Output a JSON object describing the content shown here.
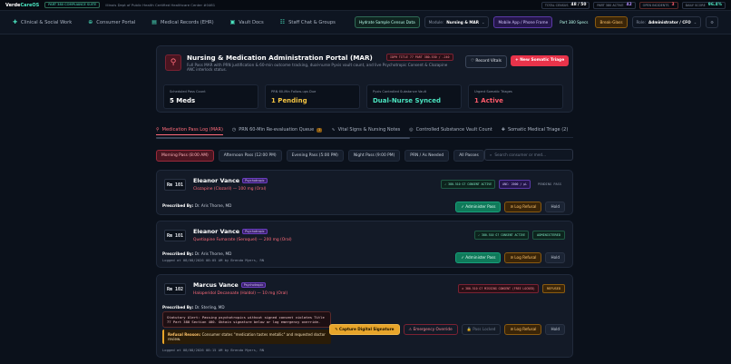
{
  "topbar": {
    "brand_a": "Verde",
    "brand_b": "CareOS",
    "suite": "PART 380 COMPLIANCE SUITE",
    "facility": "Illinois Dept of Public Health Certified Healthcare Center #0461",
    "stats": [
      {
        "label": "TOTAL CENSUS",
        "value": "48 / 50"
      },
      {
        "label": "PART 380 ACTIVE",
        "value": "42"
      },
      {
        "label": "OPEN INCIDENTS",
        "value": "3"
      },
      {
        "label": "DAILY SCORE",
        "value": "96.4%"
      }
    ]
  },
  "nav": {
    "items": [
      {
        "icon": "✚",
        "label": "Clinical & Social Work"
      },
      {
        "icon": "⊕",
        "label": "Consumer Portal"
      },
      {
        "icon": "▤",
        "label": "Medical Records (EHR)"
      },
      {
        "icon": "▣",
        "label": "Vault Docs"
      },
      {
        "icon": "☷",
        "label": "Staff Chat & Groups"
      }
    ],
    "hydrate": "Hydrate Sample Census Data",
    "module_label": "Module:",
    "module_value": "Nursing & MAR",
    "mobile": "Mobile App / Phone Frame",
    "part380": "Part 380 Specs",
    "breakglass": "Break-Glass",
    "role_label": "Role:",
    "role_value": "Administrator / CFO"
  },
  "hero": {
    "title": "Nursing & Medication Administration Portal (MAR)",
    "tag": "IDPH TITLE 77 PART 380.530 / .240",
    "desc": "Full Pass MAR with PRN justification & 60-min outcome tracking, dual-nurse Pyxis vault count, and live Psychotropic Consent & Clozapine ANC interlock status.",
    "record_vitals": "Record Vitals",
    "new_triage": "New Somatic Triage",
    "cards": [
      {
        "label": "Scheduled Pass Count",
        "value": "5 Meds",
        "color": "#ffffff"
      },
      {
        "label": "PRN 60-Min Follow-ups Due",
        "value": "1 Pending",
        "color": "#f5c542"
      },
      {
        "label": "Pyxis Controlled Substance Vault",
        "value": "Dual-Nurse Synced",
        "color": "#4be4c0"
      },
      {
        "label": "Urgent Somatic Triages",
        "value": "1 Active",
        "color": "#ff5a6a"
      }
    ]
  },
  "tabs": [
    {
      "icon": "⚲",
      "label": "Medication Pass Log (MAR)",
      "badge": ""
    },
    {
      "icon": "◷",
      "label": "PRN 60-Min Re-evaluation Queue",
      "badge": "1"
    },
    {
      "icon": "∿",
      "label": "Vital Signs & Nursing Notes",
      "badge": ""
    },
    {
      "icon": "◎",
      "label": "Controlled Substance Vault Count",
      "badge": ""
    },
    {
      "icon": "✚",
      "label": "Somatic Medical Triage (2)",
      "badge": ""
    },
    {
      "icon": "▤",
      "label": "",
      "badge": ""
    }
  ],
  "filters": [
    "Morning Pass (8:00 AM)",
    "Afternoon Pass (12:00 PM)",
    "Evening Pass (5:00 PM)",
    "Night Pass (9:00 PM)",
    "PRN / As Needed",
    "All Passes"
  ],
  "search_placeholder": "Search consumer or med...",
  "records": [
    {
      "room": "Rm 101",
      "name": "Eleanor Vance",
      "psy": "Psychotropic",
      "med": "Clozapine (Clozaril) — 100 mg (Oral)",
      "consent": "✓ 380.510 G? CONSENT ACTIVE",
      "anc": "ANC: 2000 / µL",
      "status": "PENDING PASS",
      "prescribed_label": "Prescribed By:",
      "prescriber": "Dr. Aris Thorne, MD",
      "administer": "Administer Pass",
      "log_refusal": "Log Refusal",
      "hold": "Hold"
    },
    {
      "room": "Rm 101",
      "name": "Eleanor Vance",
      "psy": "Psychotropic",
      "med": "Quetiapine Fumarate (Seroquel) — 200 mg (Oral)",
      "consent": "✓ 380.510 G? CONSENT ACTIVE",
      "status": "ADMINISTERED",
      "prescribed_label": "Prescribed By:",
      "prescriber": "Dr. Aris Thorne, MD",
      "logged": "Logged at 08/08/2026 08:05 AM by Brenda Myers, RN",
      "administer": "Administer Pass",
      "log_refusal": "Log Refusal",
      "hold": "Hold"
    },
    {
      "room": "Rm 102",
      "name": "Marcus Vance",
      "psy": "Psychotropic",
      "med": "Haloperidol Decanoate (Haldol) — 10 mg (Oral)",
      "consent": "⊘ 380.510 G? MISSING CONSENT (FREE LOCKED)",
      "status": "REFUSED",
      "prescribed_label": "Prescribed By:",
      "prescriber": "Dr. Sterling, MD",
      "warning": "Statutory Alert: Passing psychotropics without signed consent violates Title 77 Part 380 Section 400. Obtain signature below or log emergency override.",
      "refusal_label": "Refusal Reason:",
      "refusal_text": "Consumer states \"medication tastes metallic\" and requested doctor review.",
      "logged": "Logged at 08/08/2026 08:15 AM by Brenda Myers, RN",
      "capture": "Capture Digital Signature",
      "override": "Emergency Override",
      "locked": "Pass Locked",
      "log_refusal": "Log Refusal",
      "hold": "Hold"
    }
  ]
}
